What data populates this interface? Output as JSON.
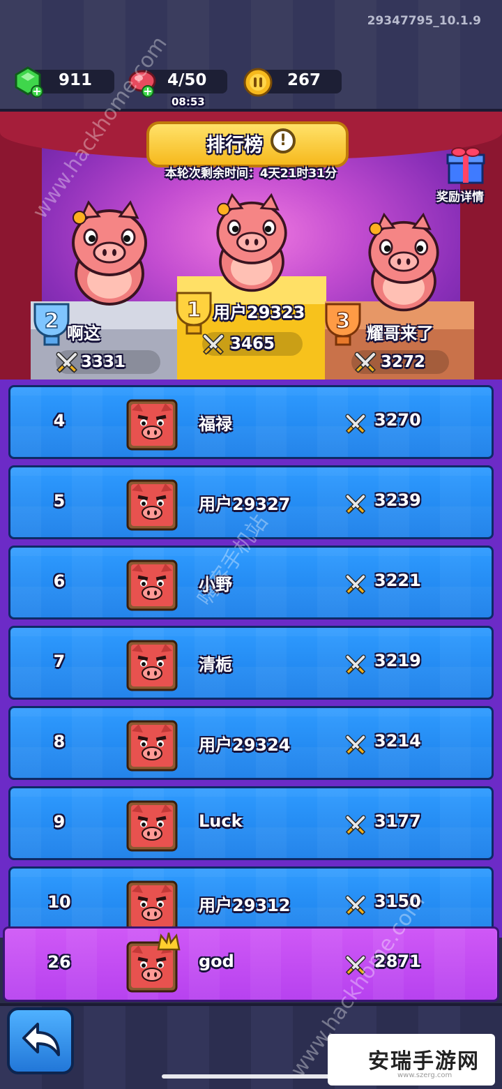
{
  "header": {
    "version": "29347795_10.1.9",
    "gems": "911",
    "energy": "4/50",
    "energy_timer": "08:53",
    "coins": "267"
  },
  "leaderboard": {
    "title": "排行榜",
    "remaining_time": "本轮次剩余时间：4天21时31分",
    "reward_label": "奖励详情"
  },
  "podium": [
    {
      "rank": "1",
      "name": "用户29323",
      "score": "3465"
    },
    {
      "rank": "2",
      "name": "啊这",
      "score": "3331"
    },
    {
      "rank": "3",
      "name": "耀哥来了",
      "score": "3272"
    }
  ],
  "rows": [
    {
      "rank": "4",
      "name": "福禄",
      "score": "3270"
    },
    {
      "rank": "5",
      "name": "用户29327",
      "score": "3239"
    },
    {
      "rank": "6",
      "name": "小野",
      "score": "3221"
    },
    {
      "rank": "7",
      "name": "清栀",
      "score": "3219"
    },
    {
      "rank": "8",
      "name": "用户29324",
      "score": "3214"
    },
    {
      "rank": "9",
      "name": "Luck",
      "score": "3177"
    },
    {
      "rank": "10",
      "name": "用户29312",
      "score": "3150"
    }
  ],
  "my_row": {
    "rank": "26",
    "name": "god",
    "score": "2871"
  },
  "watermarks": {
    "hackhome_top": "www.hackhome.com",
    "hackhome_mid": "嗨客手机站",
    "hackhome_bottom": "www.hackhome.com",
    "logo_text": "安瑞手游网",
    "logo_url": "www.szerg.com"
  },
  "colors": {
    "row_blue": "#1b7fe9",
    "row_mine": "#b742ef",
    "gold": "#f6b91d"
  }
}
